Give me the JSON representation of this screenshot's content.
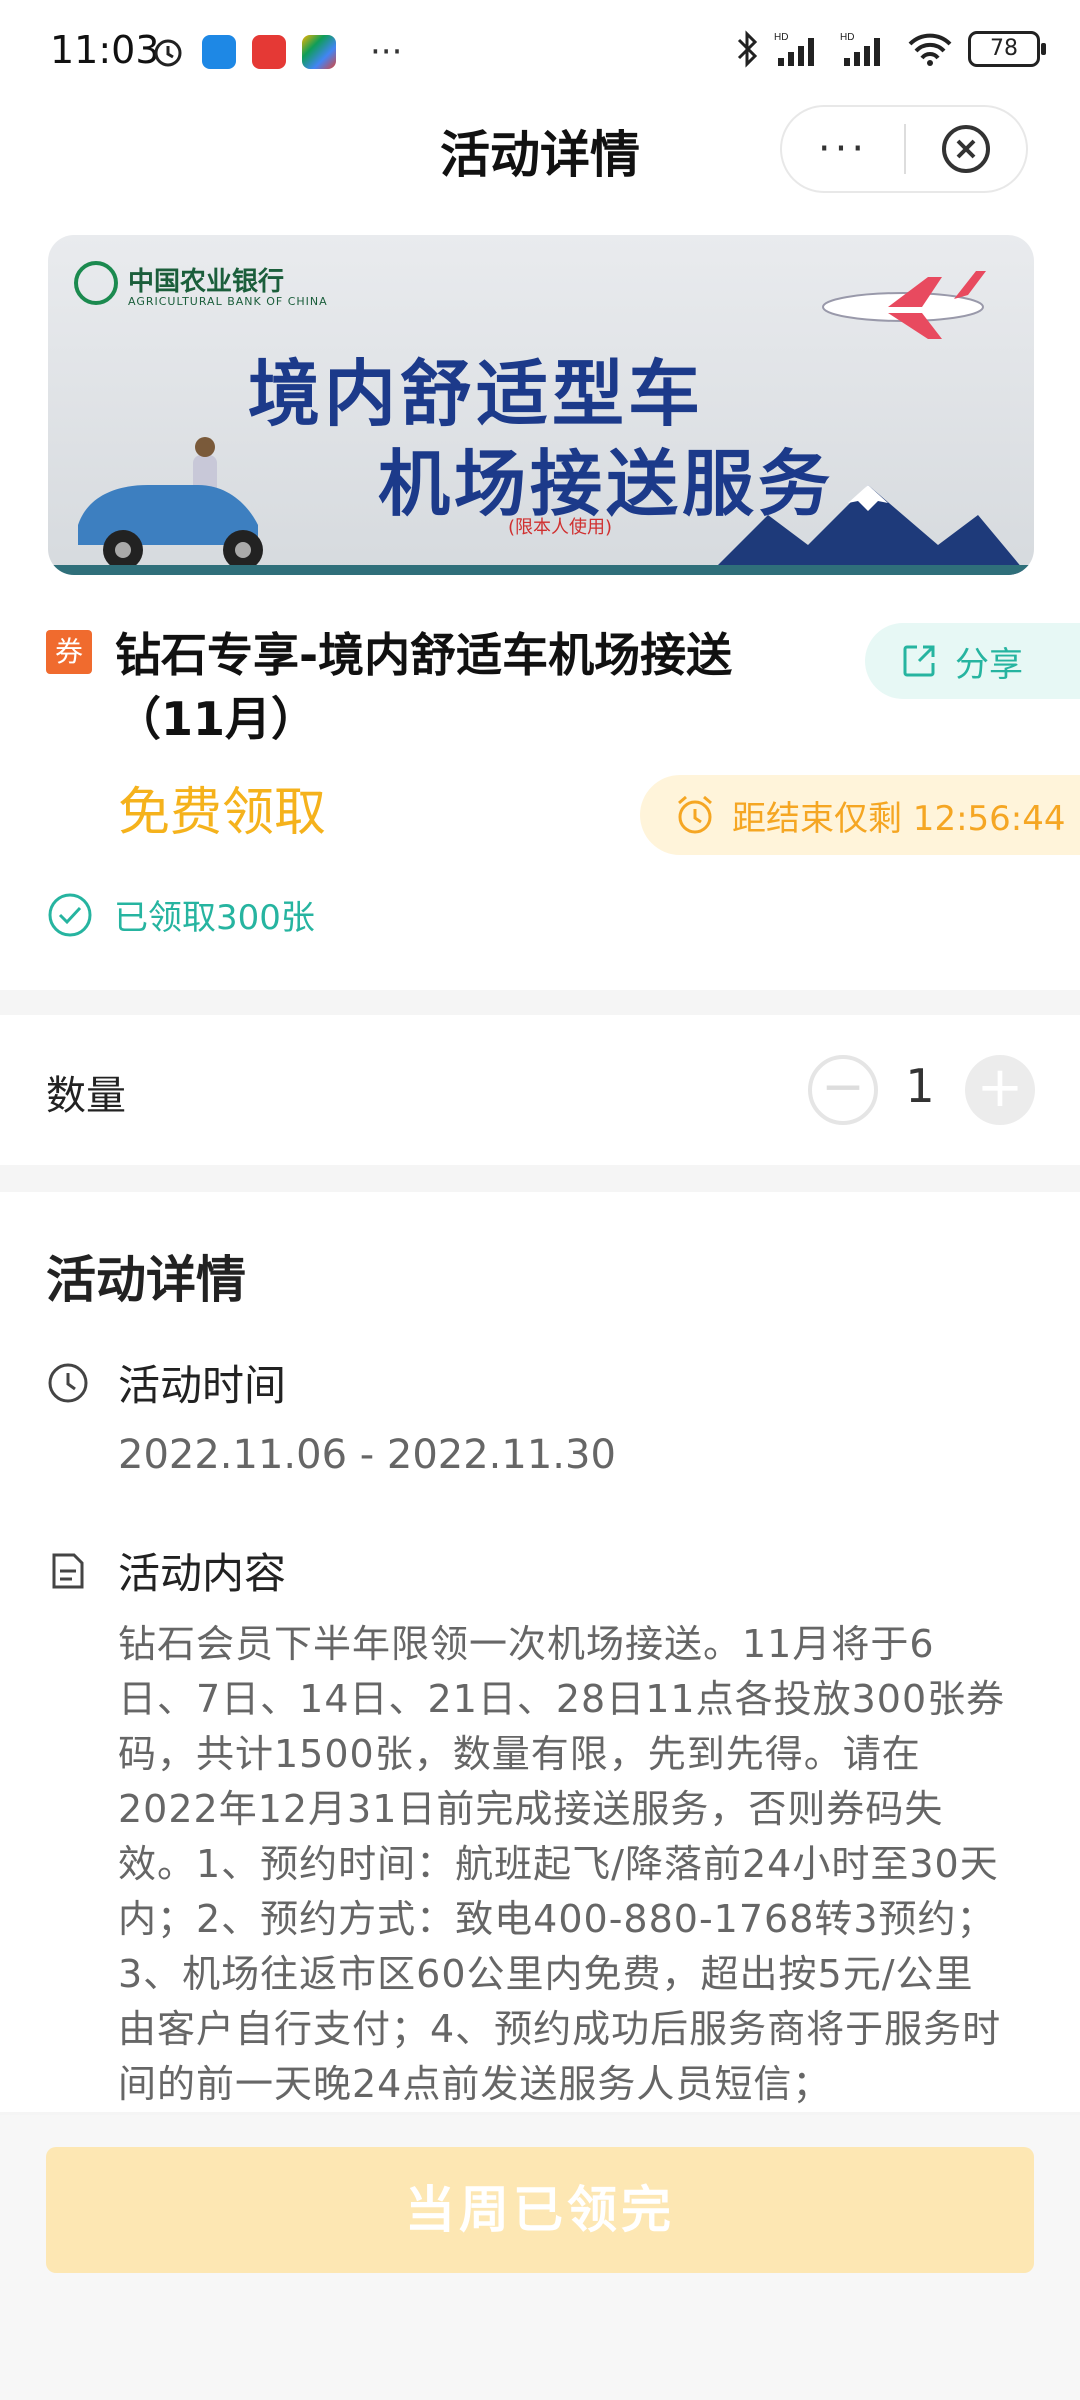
{
  "status_bar": {
    "time": "11:03",
    "overflow": "···",
    "battery": "78",
    "icons": [
      "alarm-icon",
      "app-icon",
      "app-icon",
      "app-icon",
      "bluetooth-icon",
      "signal-icon",
      "signal-icon",
      "wifi-icon",
      "battery-icon"
    ]
  },
  "nav": {
    "title": "活动详情",
    "more": "···"
  },
  "banner": {
    "bank_name": "中国农业银行",
    "bank_name_en": "AGRICULTURAL BANK OF CHINA",
    "line1": "境内舒适型车",
    "line2": "机场接送服务",
    "note": "(限本人使用)"
  },
  "product": {
    "tag": "券",
    "title": "钻石专享-境内舒适车机场接送（11月）",
    "share_label": "分享",
    "price_label": "免费领取",
    "countdown": "距结束仅剩 12:56:44",
    "claimed": "已领取300张"
  },
  "quantity": {
    "label": "数量",
    "value": "1",
    "minus": "−",
    "plus": "+"
  },
  "details": {
    "title": "活动详情",
    "time_label": "活动时间",
    "time_value": "2022.11.06 - 2022.11.30",
    "content_label": "活动内容",
    "content": "钻石会员下半年限领一次机场接送。11月将于6日、7日、14日、21日、28日11点各投放300张券码，共计1500张，数量有限，先到先得。请在2022年12月31日前完成接送服务，否则券码失效。1、预约时间：航班起飞/降落前24小时至30天内；2、预约方式：致电400-880-1768转3预约；3、机场往返市区60公里内免费，超出按5元/公里由客户自行支付；4、预约成功后服务商将于服务时间的前一天晚24点前发送服务人员短信；"
  },
  "cta": {
    "label": "当周已领完"
  },
  "colors": {
    "teal": "#26b4a0",
    "gold": "#f5b21c",
    "coupon_orange": "#f06b2e",
    "cta_disabled": "#fde7b3"
  }
}
